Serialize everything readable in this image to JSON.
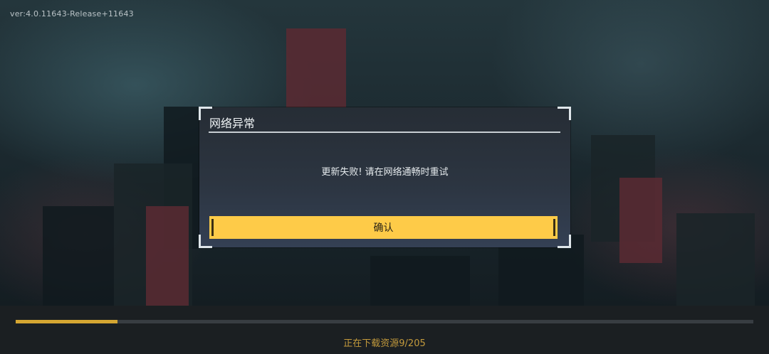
{
  "version_text": "ver:4.0.11643-Release+11643",
  "dialog": {
    "title": "网络异常",
    "message": "更新失败! 请在网络通畅时重试",
    "confirm_label": "确认"
  },
  "loading": {
    "text": "正在下载资源9/205",
    "progress_fraction": 0.138
  },
  "colors": {
    "accent_yellow": "#fecb48",
    "progress_gold": "#d5a632",
    "loading_text": "#c39a3c"
  }
}
